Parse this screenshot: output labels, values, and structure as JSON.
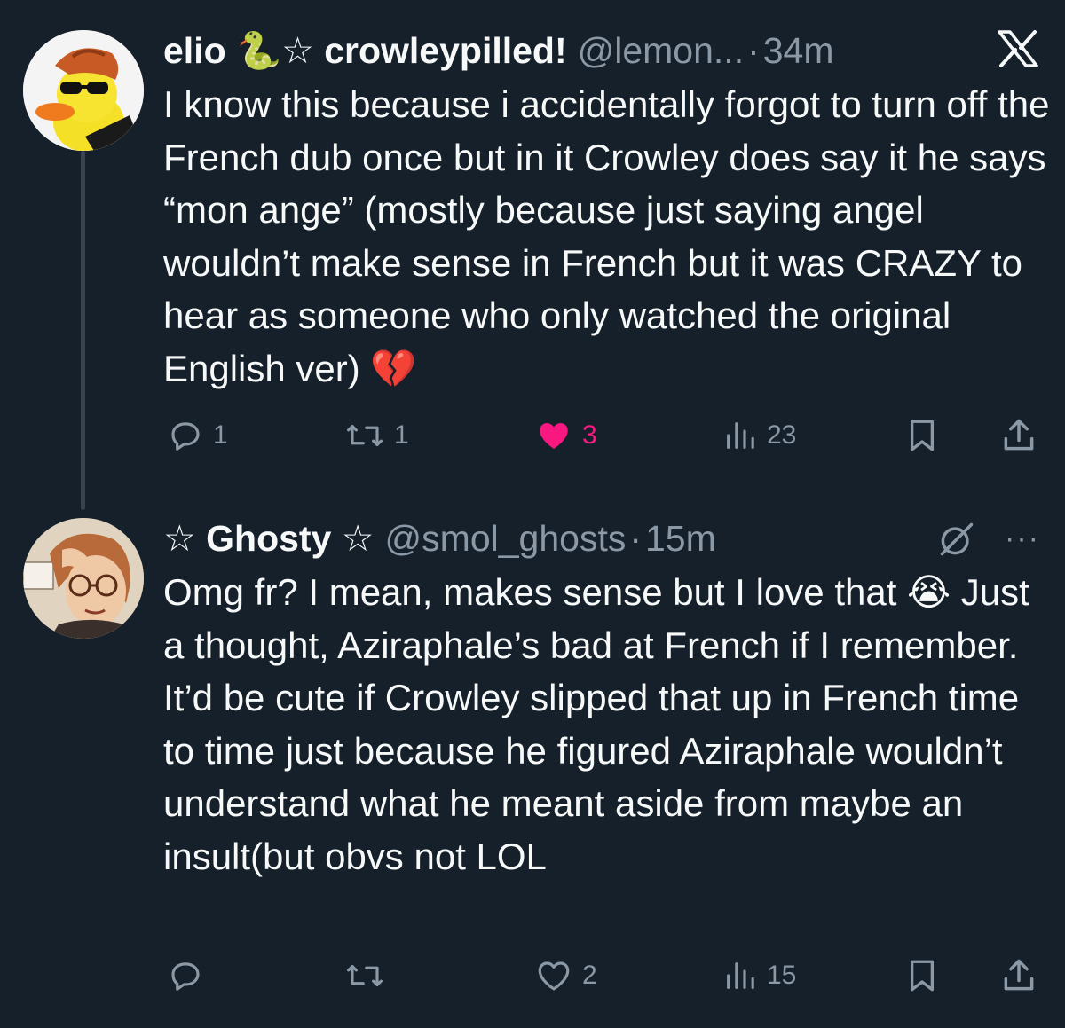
{
  "tweets": [
    {
      "display_name": "elio 🐍☆ crowleypilled!",
      "handle": "@lemon...",
      "separator": "·",
      "time": "34m",
      "text": "I know this because i accidentally forgot to turn off the French dub once but in it Crowley does say it he says “mon ange” (mostly because just saying angel wouldn’t make sense in French but it was CRAZY to hear as someone who only watched the original English ver) 💔",
      "replies": "1",
      "reposts": "1",
      "likes": "3",
      "views": "23",
      "liked": true
    },
    {
      "display_name": "☆ Ghosty ☆",
      "handle": "@smol_ghosts",
      "separator": "·",
      "time": "15m",
      "text": "Omg fr? I mean, makes sense but I love that 😭 Just a thought, Aziraphale’s bad at French if I remember. It’d be cute if Crowley slipped that up in French time to time just because he figured Aziraphale wouldn’t understand what he meant aside from maybe an insult(but obvs not LOL",
      "replies": "",
      "reposts": "",
      "likes": "2",
      "views": "15",
      "liked": false
    }
  ],
  "colors": {
    "background": "#15202b",
    "text": "#f7f9f9",
    "muted": "#8b98a5",
    "like_active": "#f91880",
    "thread_line": "#38444d"
  },
  "icons": [
    "x-logo-icon",
    "reply-icon",
    "repost-icon",
    "like-icon",
    "views-icon",
    "bookmark-icon",
    "share-icon",
    "grok-icon",
    "more-icon"
  ],
  "more_label": "···"
}
